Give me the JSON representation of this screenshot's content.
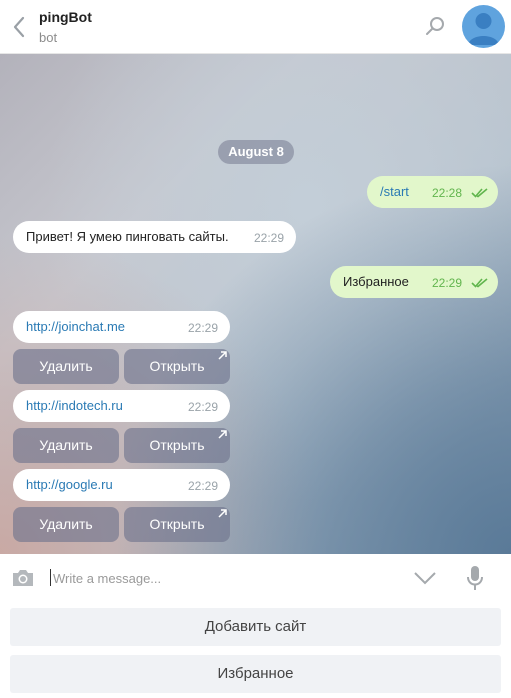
{
  "header": {
    "title": "pingBot",
    "subtitle": "bot"
  },
  "chat": {
    "date_label": "August 8",
    "messages": [
      {
        "text": "/start",
        "time": "22:28"
      },
      {
        "text": "Привет! Я умею пинговать сайты.",
        "time": "22:29"
      },
      {
        "text": "Избранное",
        "time": "22:29"
      },
      {
        "text": "http://joinchat.me",
        "time": "22:29"
      },
      {
        "text": "http://indotech.ru",
        "time": "22:29"
      },
      {
        "text": "http://google.ru",
        "time": "22:29"
      }
    ],
    "inline_buttons": {
      "delete_label": "Удалить",
      "open_label": "Открыть"
    }
  },
  "composer": {
    "placeholder": "Write a message..."
  },
  "reply_keyboard": {
    "add_site_label": "Добавить сайт",
    "favorites_label": "Избранное"
  },
  "colors": {
    "outgoing_bubble": "#e2f7cb",
    "link": "#2a7ab4",
    "read_check": "#61b54d",
    "avatar": "#5fa3de"
  },
  "icons": [
    "back-arrow-icon",
    "search-icon",
    "avatar-user-icon",
    "double-check-icon",
    "open-link-arrow-icon",
    "camera-icon",
    "chevron-down-icon",
    "microphone-icon"
  ]
}
